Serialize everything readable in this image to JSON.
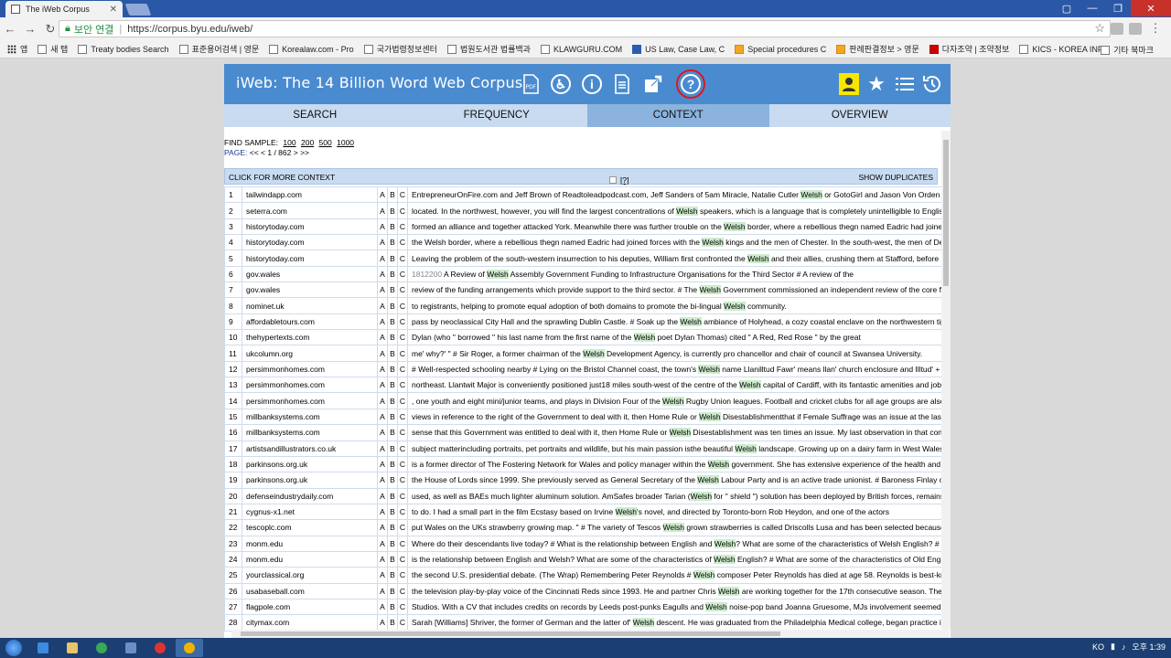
{
  "browser": {
    "tab_title": "The iWeb Corpus",
    "secure_label": "보안 연결",
    "url": "https://corpus.byu.edu/iweb/",
    "bookmarks": [
      "앱",
      "새 탭",
      "Treaty bodies Search",
      "표준용어검색 | 영문",
      "Korealaw.com - Pro",
      "국가법령정보센터",
      "법원도서관 법률백과",
      "KLAWGURU.COM",
      "US Law, Case Law, C",
      "Special procedures C",
      "판례판결정보 > 영문",
      "다자조약 | 조약정보",
      "KICS - KOREA INFO"
    ],
    "other_bookmarks": "기타 북마크"
  },
  "header": {
    "title": "iWeb: The 14 Billion Word Web Corpus",
    "icons": [
      "pdf-icon",
      "accessibility-icon",
      "info-icon",
      "document-icon",
      "external-link-icon",
      "help-icon",
      "user-icon",
      "star-icon",
      "list-icon",
      "history-icon"
    ]
  },
  "nav": {
    "search": "SEARCH",
    "frequency": "FREQUENCY",
    "context": "CONTEXT",
    "overview": "OVERVIEW"
  },
  "sampler": {
    "find_label": "FIND SAMPLE:",
    "sizes": [
      "100",
      "200",
      "500",
      "1000"
    ],
    "page_label": "PAGE:",
    "page_prev": "<< <",
    "page_info": "1 / 862",
    "page_next": "> >>"
  },
  "context_bar": {
    "more_context": "CLICK FOR MORE CONTEXT",
    "help": "[?]",
    "show_duplicates": "SHOW DUPLICATES"
  },
  "colors": {
    "header": "#4a8bd0",
    "nav": "#c8dbf0",
    "active_tab": "#8bb3dd",
    "keyword": "#cdeccd",
    "highlight_box": "#e0161b"
  },
  "rows": [
    {
      "n": "1",
      "src": "tailwindapp.com",
      "pre": "EntrepreneurOnFire.com and Jeff Brown of Readtoleadpodcast.com, Jeff Sanders of 5am Miracle, Natalie Cutler ",
      "kw": "Welsh",
      "post": " or GotoGirl and Jason Von Orden of In"
    },
    {
      "n": "2",
      "src": "seterra.com",
      "pre": "located. In the northwest, however, you will find the largest concentrations of ",
      "kw": "Welsh",
      "post": " speakers, which is a language that is completely unintelligible to English"
    },
    {
      "n": "3",
      "src": "historytoday.com",
      "pre": "formed an alliance and together attacked York. Meanwhile there was further trouble on the ",
      "kw": "Welsh",
      "post": " border, where a rebellious thegn named Eadric had joined"
    },
    {
      "n": "4",
      "src": "historytoday.com",
      "pre": "the Welsh border, where a rebellious thegn named Eadric had joined forces with the ",
      "kw": "Welsh",
      "post": " kings and the men of Chester. In the south-west, the men of Devo"
    },
    {
      "n": "5",
      "src": "historytoday.com",
      "pre": "Leaving the problem of the south-western insurrection to his deputies, William first confronted the ",
      "kw": "Welsh",
      "post": " and their allies, crushing them at Stafford, before r"
    },
    {
      "n": "6",
      "src": "gov.wales",
      "id": "1812200",
      "pre": " A Review of ",
      "kw": "Welsh",
      "post": " Assembly Government Funding to Infrastructure Organisations for the Third Sector # A review of the"
    },
    {
      "n": "7",
      "src": "gov.wales",
      "pre": "review of the funding arrangements which provide support to the third sector. # The ",
      "kw": "Welsh",
      "post": " Government commissioned an independent review of the core fu"
    },
    {
      "n": "8",
      "src": "nominet.uk",
      "pre": "to registrants, helping to promote equal adoption of both domains to promote the bi-lingual ",
      "kw": "Welsh",
      "post": " community."
    },
    {
      "n": "9",
      "src": "affordabletours.com",
      "pre": "pass by neoclassical City Hall and the sprawling Dublin Castle. # Soak up the ",
      "kw": "Welsh",
      "post": " ambiance of Holyhead, a cozy coastal enclave on the northwestern tip of"
    },
    {
      "n": "10",
      "src": "thehypertexts.com",
      "pre": "Dylan (who \" borrowed \" his last name from the first name of the ",
      "kw": "Welsh",
      "post": " poet Dylan Thomas) cited \" A Red, Red Rose \" by the great"
    },
    {
      "n": "11",
      "src": "ukcolumn.org",
      "pre": "me' why?' \" # Sir Roger, a former chairman of the ",
      "kw": "Welsh",
      "post": " Development Agency, is currently pro chancellor and chair of council at Swansea University."
    },
    {
      "n": "12",
      "src": "persimmonhomes.com",
      "pre": "# Well-respected schooling nearby # Lying on the Bristol Channel coast, the town's ",
      "kw": "Welsh",
      "post": " name Llanilltud Fawr' means llan' church enclosure and Illtud' + m"
    },
    {
      "n": "13",
      "src": "persimmonhomes.com",
      "pre": "northeast. Llantwit Major is conveniently positioned just18 miles south-west of the centre of the ",
      "kw": "Welsh",
      "post": " capital of Cardiff, with its fantastic amenities and job o"
    },
    {
      "n": "14",
      "src": "persimmonhomes.com",
      "pre": ", one youth and eight mini/junior teams, and plays in Division Four of the ",
      "kw": "Welsh",
      "post": " Rugby Union leagues. Football and cricket clubs for all age groups are also w"
    },
    {
      "n": "15",
      "src": "millbanksystems.com",
      "pre": "views in reference to the right of the Government to deal with it, then Home Rule or ",
      "kw": "Welsh",
      "post": " Disestablishmentthat if Female Suffrage was an issue at the last election"
    },
    {
      "n": "16",
      "src": "millbanksystems.com",
      "pre": "sense that this Government was entitled to deal with it, then Home Rule or ",
      "kw": "Welsh",
      "post": " Disestablishment was ten times an issue. My last observation in that conne"
    },
    {
      "n": "17",
      "src": "artistsandillustrators.co.uk",
      "pre": "subject matterincluding portraits, pet portraits and wildlife, but his main passion isthe beautiful ",
      "kw": "Welsh",
      "post": " landscape. Growing up on a dairy farm in West WalesC"
    },
    {
      "n": "18",
      "src": "parkinsons.org.uk",
      "pre": "is a former director of The Fostering Network for Wales and policy manager within the ",
      "kw": "Welsh",
      "post": " government. She has extensive experience of the health and s"
    },
    {
      "n": "19",
      "src": "parkinsons.org.uk",
      "pre": "the House of Lords since 1999. She previously served as General Secretary of the ",
      "kw": "Welsh",
      "post": " Labour Party and is an active trade unionist. # Baroness Finlay of Ll"
    },
    {
      "n": "20",
      "src": "defenseindustrydaily.com",
      "pre": "used, as well as BAEs much lighter aluminum solution. AmSafes broader Tarian (",
      "kw": "Welsh",
      "post": " for \" shield \") solution has been deployed by British forces, remains i"
    },
    {
      "n": "21",
      "src": "cygnus-x1.net",
      "pre": "to do. I had a small part in the film Ecstasy based on Irvine ",
      "kw": "Welsh",
      "post": "'s novel, and directed by Toronto-born Rob Heydon, and one of the actors"
    },
    {
      "n": "22",
      "src": "tescoplc.com",
      "pre": "put Wales on the UKs strawberry growing map. \" # The variety of Tescos ",
      "kw": "Welsh",
      "post": " grown strawberries is called Driscolls Lusa and has been selected because o"
    },
    {
      "n": "23",
      "src": "monm.edu",
      "pre": "Where do their descendants live today? # What is the relationship between English and ",
      "kw": "Welsh",
      "post": "? What are some of the characteristics of Welsh English? # Wh"
    },
    {
      "n": "24",
      "src": "monm.edu",
      "pre": "is the relationship between English and Welsh? What are some of the characteristics of ",
      "kw": "Welsh",
      "post": " English? # What are some of the characteristics of Old English"
    },
    {
      "n": "25",
      "src": "yourclassical.org",
      "pre": "the second U.S. presidential debate. (The Wrap) Remembering Peter Reynolds # ",
      "kw": "Welsh",
      "post": " composer Peter Reynolds has died at age 58. Reynolds is best-known"
    },
    {
      "n": "26",
      "src": "usabaseball.com",
      "pre": "the television play-by-play voice of the Cincinnati Reds since 1993. He and partner Chris ",
      "kw": "Welsh",
      "post": " are working together for the 17th consecutive season. They a"
    },
    {
      "n": "27",
      "src": "flagpole.com",
      "pre": "Studios. With a CV that includes credits on records by Leeds post-punks Eagulls and ",
      "kw": "Welsh",
      "post": " noise-pop band Joanna Gruesome, MJs involvement seemed ideal"
    },
    {
      "n": "28",
      "src": "citymax.com",
      "pre": "Sarah [Williams] Shriver, the former of German and the latter of' ",
      "kw": "Welsh",
      "post": " descent. He was graduated from the Philadelphia Medical college, began practice in"
    }
  ],
  "taskbar": {
    "time": "오후 1:39",
    "ime": "KO"
  }
}
